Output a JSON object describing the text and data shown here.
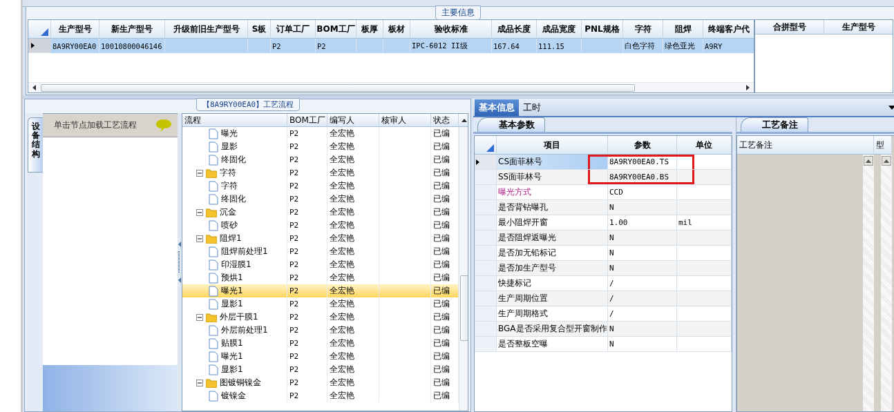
{
  "main_info": {
    "title": "主要信息",
    "columns": [
      "生产型号",
      "新生产型号",
      "升级前旧生产型号",
      "S板",
      "订单工厂",
      "BOM工厂",
      "板厚",
      "板材",
      "验收标准",
      "成品长度",
      "成品宽度",
      "PNL规格",
      "字符",
      "阻焊",
      "终端客户代"
    ],
    "rows": [
      {
        "selected": true,
        "cells": [
          "8A9RY00EA0",
          "10010800046146",
          "",
          "",
          "P2",
          "P2",
          "",
          "",
          "IPC-6012 II级",
          "167.64",
          "111.15",
          "",
          "白色字符",
          "绿色亚光",
          "A9RY"
        ]
      }
    ],
    "side_columns": [
      "合拼型号",
      "生产型号"
    ]
  },
  "flow": {
    "title": "【8A9RY00EA0】工艺流程",
    "side_tab": "设备结构",
    "hint": "单击节点加载工艺流程",
    "columns": [
      "流程",
      "BOM工厂",
      "编写人",
      "核审人",
      "状态"
    ],
    "tree": [
      {
        "children": [
          {
            "label": "曝光",
            "bom": "P2",
            "writer": "全宏艳",
            "status": "已编",
            "selected": false
          },
          {
            "label": "显影",
            "bom": "P2",
            "writer": "全宏艳",
            "status": "已编",
            "selected": false
          },
          {
            "label": "终固化",
            "bom": "P2",
            "writer": "全宏艳",
            "status": "已编",
            "selected": false
          }
        ]
      },
      {
        "label": "字符",
        "bom": "P2",
        "writer": "全宏艳",
        "status": "已编",
        "selected": false,
        "expanded": true,
        "children": [
          {
            "label": "字符",
            "bom": "P2",
            "writer": "全宏艳",
            "status": "已编",
            "selected": false
          },
          {
            "label": "终固化",
            "bom": "P2",
            "writer": "全宏艳",
            "status": "已编",
            "selected": false
          }
        ]
      },
      {
        "label": "沉金",
        "bom": "P2",
        "writer": "全宏艳",
        "status": "已编",
        "selected": false,
        "expanded": true,
        "children": [
          {
            "label": "喷砂",
            "bom": "P2",
            "writer": "全宏艳",
            "status": "已编",
            "selected": false
          }
        ]
      },
      {
        "label": "阻焊1",
        "bom": "P2",
        "writer": "全宏艳",
        "status": "已编",
        "selected": false,
        "expanded": true,
        "children": [
          {
            "label": "阻焊前处理1",
            "bom": "P2",
            "writer": "全宏艳",
            "status": "已编",
            "selected": false
          },
          {
            "label": "印湿膜1",
            "bom": "P2",
            "writer": "全宏艳",
            "status": "已编",
            "selected": false
          },
          {
            "label": "预烘1",
            "bom": "P2",
            "writer": "全宏艳",
            "status": "已编",
            "selected": false
          },
          {
            "label": "曝光1",
            "bom": "P2",
            "writer": "全宏艳",
            "status": "已编",
            "selected": true
          },
          {
            "label": "显影1",
            "bom": "P2",
            "writer": "全宏艳",
            "status": "已编",
            "selected": false
          }
        ]
      },
      {
        "label": "外层干膜1",
        "bom": "P2",
        "writer": "全宏艳",
        "status": "已编",
        "selected": false,
        "expanded": true,
        "children": [
          {
            "label": "外层前处理1",
            "bom": "P2",
            "writer": "全宏艳",
            "status": "已编",
            "selected": false
          },
          {
            "label": "贴膜1",
            "bom": "P2",
            "writer": "全宏艳",
            "status": "已编",
            "selected": false
          },
          {
            "label": "曝光1",
            "bom": "P2",
            "writer": "全宏艳",
            "status": "已编",
            "selected": false
          },
          {
            "label": "显影1",
            "bom": "P2",
            "writer": "全宏艳",
            "status": "已编",
            "selected": false
          }
        ]
      },
      {
        "label": "图镀铜镍金",
        "bom": "P2",
        "writer": "全宏艳",
        "status": "已编",
        "selected": false,
        "expanded": true,
        "children": [
          {
            "label": "镀镍金",
            "bom": "P2",
            "writer": "全宏艳",
            "status": "已编",
            "selected": false
          }
        ]
      }
    ]
  },
  "detail": {
    "tabs": [
      {
        "label": "基本信息",
        "selected": true
      },
      {
        "label": "工时",
        "selected": false
      }
    ],
    "sub_tab": "基本参数",
    "columns": [
      "项目",
      "参数",
      "单位"
    ],
    "rows": [
      {
        "item": "CS面菲林号",
        "value": "8A9RY00EA0.TS",
        "unit": "",
        "selected": true,
        "emphasis": false,
        "highlighted": true
      },
      {
        "item": "SS面菲林号",
        "value": "8A9RY00EA0.BS",
        "unit": "",
        "selected": false,
        "emphasis": false,
        "highlighted": true
      },
      {
        "item": "曝光方式",
        "value": "CCD",
        "unit": "",
        "selected": false,
        "emphasis": true,
        "highlighted": false
      },
      {
        "item": "是否背钻曝孔",
        "value": "N",
        "unit": "",
        "selected": false,
        "emphasis": false,
        "highlighted": false
      },
      {
        "item": "最小阻焊开窗",
        "value": "1.00",
        "unit": "mil",
        "selected": false,
        "emphasis": false,
        "highlighted": false
      },
      {
        "item": "是否阻焊返曝光",
        "value": "N",
        "unit": "",
        "selected": false,
        "emphasis": false,
        "highlighted": false
      },
      {
        "item": "是否加无铅标记",
        "value": "N",
        "unit": "",
        "selected": false,
        "emphasis": false,
        "highlighted": false
      },
      {
        "item": "是否加生产型号",
        "value": "N",
        "unit": "",
        "selected": false,
        "emphasis": false,
        "highlighted": false
      },
      {
        "item": "快捷标记",
        "value": "/",
        "unit": "",
        "selected": false,
        "emphasis": false,
        "highlighted": false
      },
      {
        "item": "生产周期位置",
        "value": "/",
        "unit": "",
        "selected": false,
        "emphasis": false,
        "highlighted": false
      },
      {
        "item": "生产周期格式",
        "value": "/",
        "unit": "",
        "selected": false,
        "emphasis": false,
        "highlighted": false
      },
      {
        "item": "BGA是否采用复合型开窗制作",
        "value": "N",
        "unit": "",
        "selected": false,
        "emphasis": false,
        "highlighted": false
      },
      {
        "item": "是否整板空曝",
        "value": "N",
        "unit": "",
        "selected": false,
        "emphasis": false,
        "highlighted": false
      }
    ]
  },
  "remarks": {
    "tab": "工艺备注",
    "columns": [
      "工艺备注",
      "型"
    ]
  }
}
